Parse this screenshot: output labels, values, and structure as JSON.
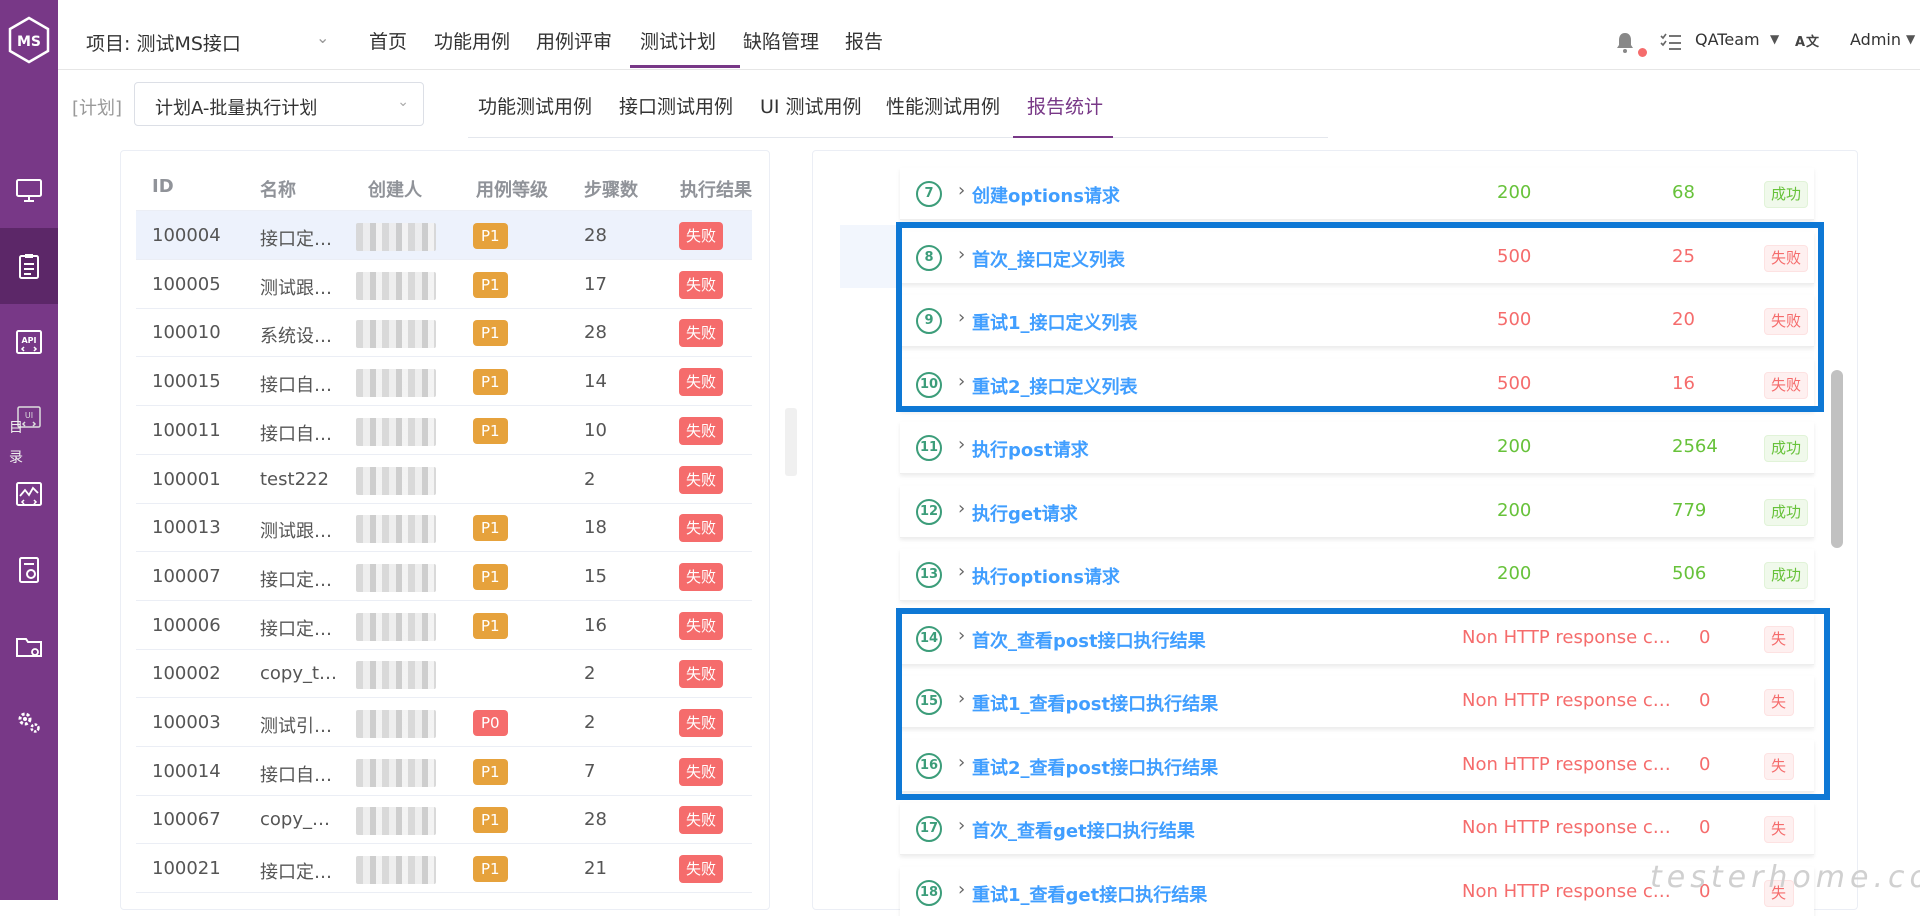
{
  "sidebar": {
    "logo": "MS",
    "items": [
      {
        "icon": "monitor-icon"
      },
      {
        "icon": "clipboard-icon"
      },
      {
        "icon": "api-icon",
        "text": "API"
      },
      {
        "icon": "ui-icon",
        "text": "UI"
      },
      {
        "icon": "performance-icon"
      },
      {
        "icon": "report-icon"
      },
      {
        "icon": "folder-settings-icon"
      },
      {
        "icon": "settings-gears-icon"
      }
    ],
    "catalog_label_1": "目",
    "catalog_label_2": "录"
  },
  "header": {
    "project": "项目: 测试MS接口",
    "nav": [
      "首页",
      "功能用例",
      "用例评审",
      "测试计划",
      "缺陷管理",
      "报告"
    ],
    "active_nav": "测试计划",
    "team": "QATeam",
    "lang": "A文",
    "user": "Admin"
  },
  "plan": {
    "label": "[计划]",
    "selected": "计划A-批量执行计划",
    "tabs": [
      "功能测试用例",
      "接口测试用例",
      "UI 测试用例",
      "性能测试用例",
      "报告统计"
    ],
    "active_tab": "报告统计"
  },
  "case_table": {
    "headers": [
      "ID",
      "名称",
      "创建人",
      "用例等级",
      "步骤数",
      "执行结果"
    ],
    "rows": [
      {
        "id": "100004",
        "name": "接口定…",
        "level": "P1",
        "steps": "28",
        "result": "失败"
      },
      {
        "id": "100005",
        "name": "测试跟…",
        "level": "P1",
        "steps": "17",
        "result": "失败"
      },
      {
        "id": "100010",
        "name": "系统设…",
        "level": "P1",
        "steps": "28",
        "result": "失败"
      },
      {
        "id": "100015",
        "name": "接口自…",
        "level": "P1",
        "steps": "14",
        "result": "失败"
      },
      {
        "id": "100011",
        "name": "接口自…",
        "level": "P1",
        "steps": "10",
        "result": "失败"
      },
      {
        "id": "100001",
        "name": "test222",
        "level": "",
        "steps": "2",
        "result": "失败"
      },
      {
        "id": "100013",
        "name": "测试跟…",
        "level": "P1",
        "steps": "18",
        "result": "失败"
      },
      {
        "id": "100007",
        "name": "接口定…",
        "level": "P1",
        "steps": "15",
        "result": "失败"
      },
      {
        "id": "100006",
        "name": "接口定…",
        "level": "P1",
        "steps": "16",
        "result": "失败"
      },
      {
        "id": "100002",
        "name": "copy_t…",
        "level": "",
        "steps": "2",
        "result": "失败"
      },
      {
        "id": "100003",
        "name": "测试引…",
        "level": "P0",
        "steps": "2",
        "result": "失败"
      },
      {
        "id": "100014",
        "name": "接口自…",
        "level": "P1",
        "steps": "7",
        "result": "失败"
      },
      {
        "id": "100067",
        "name": "copy_…",
        "level": "P1",
        "steps": "28",
        "result": "失败"
      },
      {
        "id": "100021",
        "name": "接口定…",
        "level": "P1",
        "steps": "21",
        "result": "失败"
      }
    ]
  },
  "steps": [
    {
      "num": "7",
      "name": "创建options请求",
      "code": "200",
      "time": "68",
      "status": "成功",
      "ok": true
    },
    {
      "num": "8",
      "name": "首次_接口定义列表",
      "code": "500",
      "time": "25",
      "status": "失败",
      "ok": false
    },
    {
      "num": "9",
      "name": "重试1_接口定义列表",
      "code": "500",
      "time": "20",
      "status": "失败",
      "ok": false
    },
    {
      "num": "10",
      "name": "重试2_接口定义列表",
      "code": "500",
      "time": "16",
      "status": "失败",
      "ok": false
    },
    {
      "num": "11",
      "name": "执行post请求",
      "code": "200",
      "time": "2564",
      "status": "成功",
      "ok": true
    },
    {
      "num": "12",
      "name": "执行get请求",
      "code": "200",
      "time": "779",
      "status": "成功",
      "ok": true
    },
    {
      "num": "13",
      "name": "执行options请求",
      "code": "200",
      "time": "506",
      "status": "成功",
      "ok": true
    },
    {
      "num": "14",
      "name": "首次_查看post接口执行结果",
      "code": "Non HTTP response c…",
      "time": "0",
      "status": "失败",
      "ok": false
    },
    {
      "num": "15",
      "name": "重试1_查看post接口执行结果",
      "code": "Non HTTP response c…",
      "time": "0",
      "status": "失败",
      "ok": false
    },
    {
      "num": "16",
      "name": "重试2_查看post接口执行结果",
      "code": "Non HTTP response c…",
      "time": "0",
      "status": "失败",
      "ok": false
    },
    {
      "num": "17",
      "name": "首次_查看get接口执行结果",
      "code": "Non HTTP response c…",
      "time": "0",
      "status": "失败",
      "ok": false
    },
    {
      "num": "18",
      "name": "重试1_查看get接口执行结果",
      "code": "Non HTTP response c…",
      "time": "0",
      "status": "失败",
      "ok": false
    }
  ],
  "watermark": "testerhome.com",
  "colors": {
    "brand": "#783887",
    "success": "#67c23a",
    "danger": "#f56c6c",
    "link": "#409eff",
    "highlight_box": "#0e78d5"
  }
}
